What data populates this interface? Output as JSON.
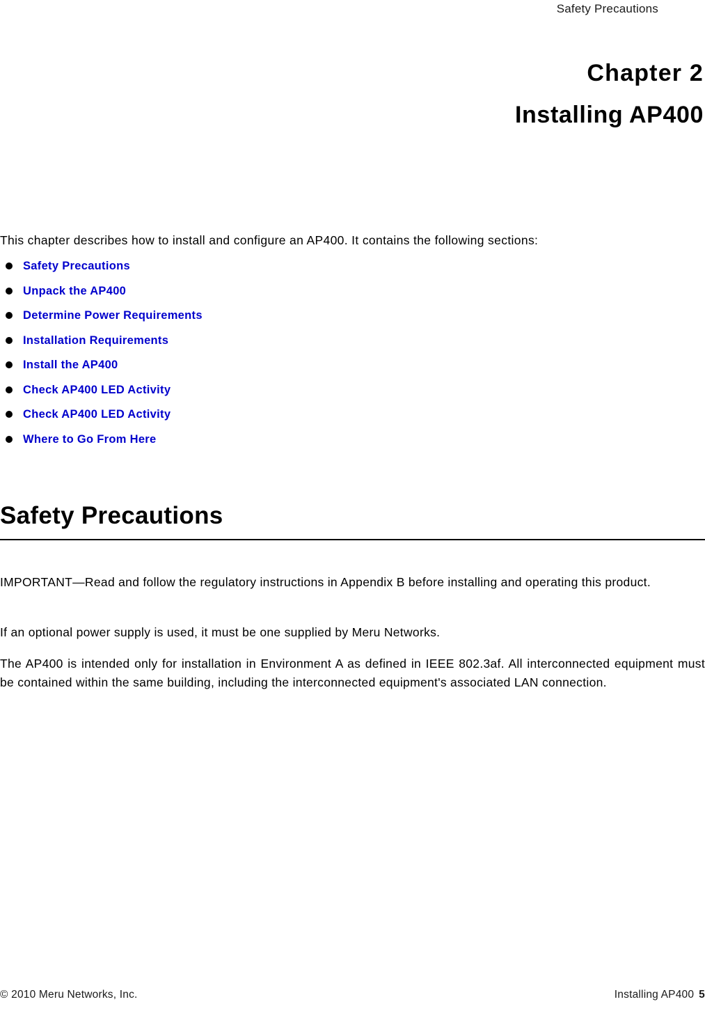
{
  "header": {
    "running_head": "Safety Precautions"
  },
  "chapter": {
    "number_label": "Chapter 2",
    "title": "Installing AP400"
  },
  "intro": {
    "text": "This chapter describes how to install and configure an AP400. It contains the following sections:"
  },
  "section_links": [
    {
      "label": "Safety Precautions"
    },
    {
      "label": "Unpack the AP400"
    },
    {
      "label": "Determine Power Requirements"
    },
    {
      "label": "Installation Requirements"
    },
    {
      "label": "Install the AP400"
    },
    {
      "label": "Check AP400 LED Activity"
    },
    {
      "label": "Check AP400 LED Activity"
    },
    {
      "label": "Where to Go From Here"
    }
  ],
  "section": {
    "heading": "Safety Precautions",
    "paragraphs": [
      "IMPORTANT—Read and follow the regulatory instructions in Appendix B before installing and operating this product.",
      "If an optional power supply is used, it must be one supplied by Meru Networks.",
      "The AP400 is intended only for installation in Environment A as defined in IEEE 802.3af. All interconnected equipment must be contained within the same building, including the interconnected equipment's associated LAN connection."
    ]
  },
  "footer": {
    "copyright": "© 2010 Meru Networks, Inc.",
    "document_title": "Installing AP400",
    "page_number": "5"
  },
  "colors": {
    "link_blue": "#0000cc",
    "text_black": "#000000",
    "rule_black": "#000000"
  }
}
